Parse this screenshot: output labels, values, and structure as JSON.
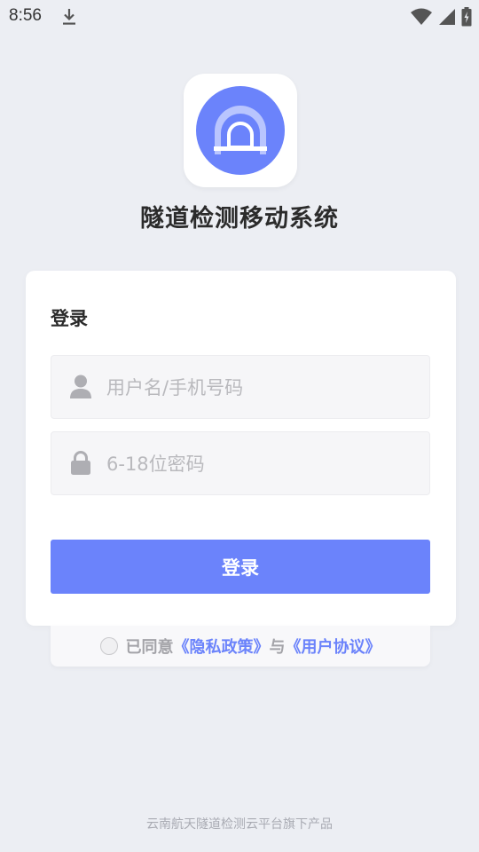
{
  "status": {
    "time": "8:56"
  },
  "icons": {
    "download": "download-icon",
    "wifi": "wifi-icon",
    "signal": "signal-icon",
    "battery": "battery-icon",
    "logo": "tunnel-icon",
    "user": "user-icon",
    "lock": "lock-icon"
  },
  "app": {
    "title": "隧道检测移动系统"
  },
  "login": {
    "title": "登录",
    "username_placeholder": "用户名/手机号码",
    "password_placeholder": "6-18位密码",
    "button_label": "登录"
  },
  "agreement": {
    "prefix": "已同意",
    "privacy_link": "《隐私政策》",
    "joiner": "与",
    "user_link": "《用户协议》",
    "checked": false
  },
  "footer": {
    "text": "云南航天隧道检测云平台旗下产品"
  },
  "colors": {
    "accent": "#6b83fb",
    "background": "#eceef3"
  }
}
